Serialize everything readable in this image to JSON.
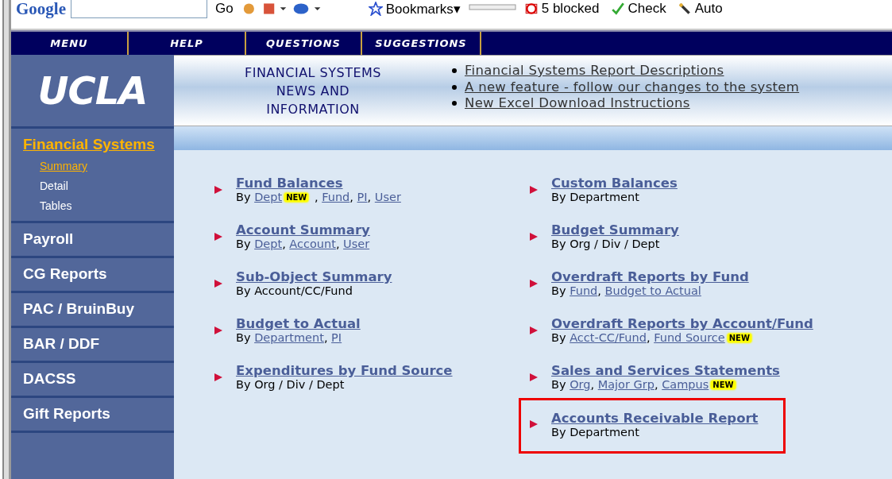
{
  "browser_toolbar": {
    "logo": "Google",
    "items": [
      {
        "kind": "go",
        "text": "Go"
      },
      {
        "kind": "bookmarks",
        "text": "Bookmarks▾"
      },
      {
        "kind": "blocked",
        "text": "5 blocked"
      },
      {
        "kind": "check",
        "text": "Check"
      },
      {
        "kind": "auto",
        "text": "Auto"
      }
    ]
  },
  "top_menu": [
    {
      "label": "MENU"
    },
    {
      "label": "HELP"
    },
    {
      "label": "QUESTIONS"
    },
    {
      "label": "SUGGESTIONS"
    }
  ],
  "logo": "UCLA",
  "news": {
    "title_lines": [
      "FINANCIAL SYSTEMS",
      "NEWS AND",
      "INFORMATION"
    ],
    "links": [
      "Financial Systems Report Descriptions",
      "A new feature - follow our changes to the system",
      "New Excel Download Instructions"
    ]
  },
  "sidebar": {
    "items": [
      {
        "label": "Financial Systems",
        "selected": true,
        "children": [
          {
            "label": "Summary",
            "selected": true
          },
          {
            "label": "Detail",
            "selected": false
          },
          {
            "label": "Tables",
            "selected": false
          }
        ]
      },
      {
        "label": "Payroll",
        "selected": false
      },
      {
        "label": "CG Reports",
        "selected": false
      },
      {
        "label": "PAC / BruinBuy",
        "selected": false
      },
      {
        "label": "BAR / DDF",
        "selected": false
      },
      {
        "label": "DACSS",
        "selected": false
      },
      {
        "label": "Gift Reports",
        "selected": false
      }
    ]
  },
  "report_columns": [
    {
      "reports": [
        {
          "title": "Fund Balances",
          "highlighted": false,
          "segments": [
            {
              "kind": "text",
              "text": "By "
            },
            {
              "kind": "link",
              "text": "Dept"
            },
            {
              "kind": "badge",
              "text": "NEW"
            },
            {
              "kind": "text",
              "text": " , "
            },
            {
              "kind": "link",
              "text": "Fund"
            },
            {
              "kind": "text",
              "text": ", "
            },
            {
              "kind": "link",
              "text": "PI"
            },
            {
              "kind": "text",
              "text": ", "
            },
            {
              "kind": "link",
              "text": "User"
            }
          ]
        },
        {
          "title": "Account Summary",
          "highlighted": false,
          "segments": [
            {
              "kind": "text",
              "text": "By "
            },
            {
              "kind": "link",
              "text": "Dept"
            },
            {
              "kind": "text",
              "text": ", "
            },
            {
              "kind": "link",
              "text": "Account"
            },
            {
              "kind": "text",
              "text": ", "
            },
            {
              "kind": "link",
              "text": "User"
            }
          ]
        },
        {
          "title": "Sub-Object Summary",
          "highlighted": false,
          "segments": [
            {
              "kind": "text",
              "text": "By Account/CC/Fund"
            }
          ]
        },
        {
          "title": "Budget to Actual",
          "highlighted": false,
          "segments": [
            {
              "kind": "text",
              "text": "By "
            },
            {
              "kind": "link",
              "text": "Department"
            },
            {
              "kind": "text",
              "text": ", "
            },
            {
              "kind": "link",
              "text": "PI"
            }
          ]
        },
        {
          "title": "Expenditures by Fund Source",
          "highlighted": false,
          "segments": [
            {
              "kind": "text",
              "text": "By Org / Div / Dept"
            }
          ]
        }
      ]
    },
    {
      "reports": [
        {
          "title": "Custom Balances",
          "highlighted": false,
          "segments": [
            {
              "kind": "text",
              "text": "By Department"
            }
          ]
        },
        {
          "title": "Budget Summary",
          "highlighted": false,
          "segments": [
            {
              "kind": "text",
              "text": "By Org / Div / Dept"
            }
          ]
        },
        {
          "title": "Overdraft Reports by Fund",
          "highlighted": false,
          "segments": [
            {
              "kind": "text",
              "text": "By "
            },
            {
              "kind": "link",
              "text": "Fund"
            },
            {
              "kind": "text",
              "text": ", "
            },
            {
              "kind": "link",
              "text": "Budget to Actual"
            }
          ]
        },
        {
          "title": "Overdraft Reports by Account/Fund",
          "highlighted": false,
          "segments": [
            {
              "kind": "text",
              "text": "By "
            },
            {
              "kind": "link",
              "text": "Acct-CC/Fund"
            },
            {
              "kind": "text",
              "text": ", "
            },
            {
              "kind": "link",
              "text": "Fund Source"
            },
            {
              "kind": "badge",
              "text": "NEW"
            }
          ]
        },
        {
          "title": "Sales and Services Statements",
          "highlighted": false,
          "segments": [
            {
              "kind": "text",
              "text": "By "
            },
            {
              "kind": "link",
              "text": "Org"
            },
            {
              "kind": "text",
              "text": ", "
            },
            {
              "kind": "link",
              "text": "Major Grp"
            },
            {
              "kind": "text",
              "text": ", "
            },
            {
              "kind": "link",
              "text": "Campus"
            },
            {
              "kind": "badge",
              "text": "NEW"
            }
          ]
        },
        {
          "title": "Accounts Receivable Report",
          "highlighted": true,
          "segments": [
            {
              "kind": "text",
              "text": "By Department"
            }
          ]
        }
      ]
    }
  ]
}
